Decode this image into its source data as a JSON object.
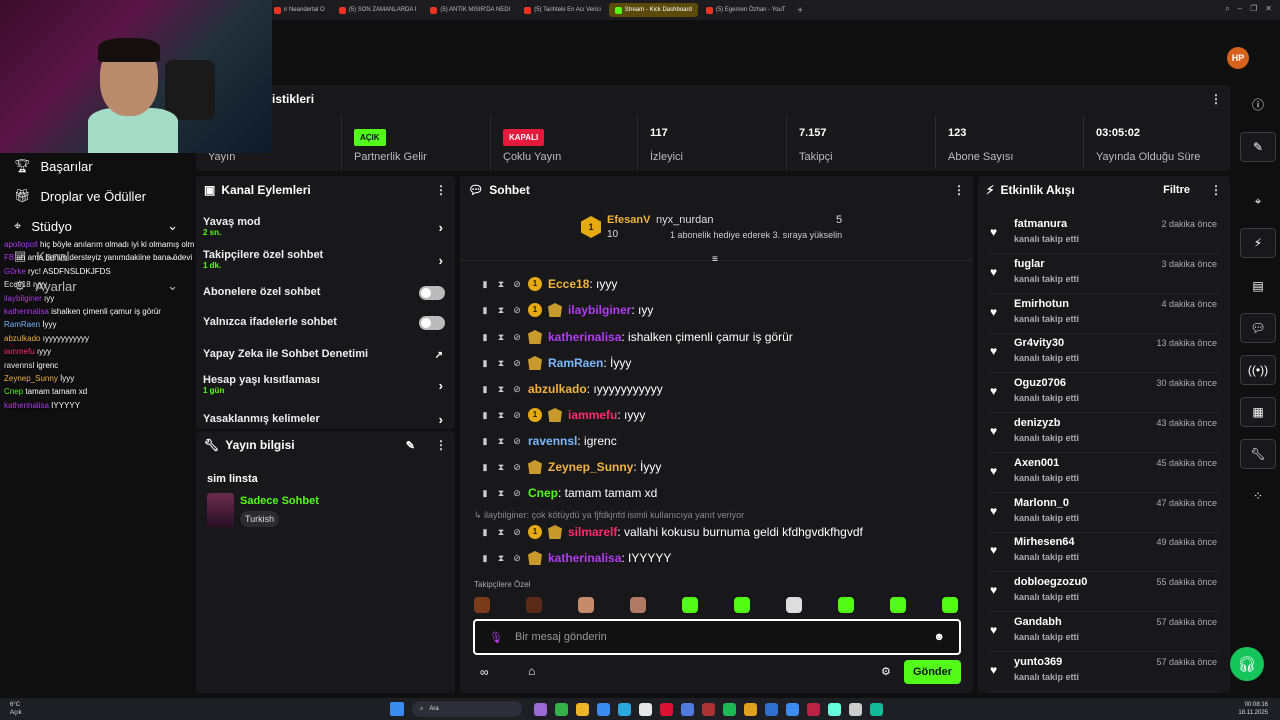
{
  "browser": {
    "tabs": [
      {
        "title": "ir Neandertal O"
      },
      {
        "title": "(5) SON ZAMANLARDA I"
      },
      {
        "title": "(5) ANTİK MISIR'DA NEDI"
      },
      {
        "title": "(5) Tarihteki En Acı Verici"
      },
      {
        "title": "Stream - Kick Dashboard",
        "active": true
      },
      {
        "title": "(5) Egemen Özhan - YouT"
      }
    ],
    "new_tab": "+"
  },
  "stats": {
    "title": "istikleri",
    "cells": [
      {
        "label": "Yayın",
        "value": ""
      },
      {
        "label": "Partnerlik Gelir",
        "badge": "AÇIK"
      },
      {
        "label": "Çoklu Yayın",
        "badge": "KAPALI"
      },
      {
        "label": "İzleyici",
        "value": "117"
      },
      {
        "label": "Takipçi",
        "value": "7.157"
      },
      {
        "label": "Abone Sayısı",
        "value": "123"
      },
      {
        "label": "Yayında Olduğu Süre",
        "value": "03:05:02"
      }
    ]
  },
  "nav": {
    "items": [
      {
        "label": "Başarılar",
        "icon": "trophy-icon"
      },
      {
        "label": "Droplar ve Ödüller",
        "icon": "gift-icon"
      },
      {
        "label": "Stüdyo",
        "icon": "studio-icon"
      },
      {
        "label": "Kanal",
        "icon": "channel-icon"
      },
      {
        "label": "Ayarlar",
        "icon": "settings-icon"
      }
    ]
  },
  "overlay_chat": [
    {
      "user": "apollopoll",
      "text": "hiç böyle anılarım olmadı iyi ki olmamış olmazda",
      "color": "#b13cf0"
    },
    {
      "user": "FB",
      "text": "ah ama benim dersteyiz yanımdakiine bana ödevi ilan al ukuğum. alpert çıktı ama kimse anlamadı",
      "color": "#b13cf0"
    },
    {
      "user": "G0rke",
      "text": "ryc! ASDFNSLDKJFDS",
      "color": "#b13cf0"
    },
    {
      "user": "Ecce18",
      "text": "ıyyy",
      "color": "#e7e7e7"
    },
    {
      "user": "ilaybilginer",
      "text": "ıyy",
      "color": "#b13cf0"
    },
    {
      "user": "katherinalisa",
      "text": "ishalken çimenli çamur iş görür",
      "color": "#b13cf0"
    },
    {
      "user": "RamRaen",
      "text": "İyyy",
      "color": "#7ab8ff"
    },
    {
      "user": "abzulkado",
      "text": "ıyyyyyyyyyyy",
      "color": "#f2b33d"
    },
    {
      "user": "iammefu",
      "text": "ıyyy",
      "color": "#ff2a6d"
    },
    {
      "user": "ravennsl",
      "text": "igrenc",
      "color": "#e7e7e7"
    },
    {
      "user": "Zeynep_Sunny",
      "text": "İyyy",
      "color": "#f2b33d"
    },
    {
      "user": "Cnep",
      "text": "tamam tamam xd",
      "color": "#53fc18"
    },
    {
      "user": "katherinalisa",
      "text": "IYYYYY",
      "color": "#b13cf0"
    }
  ],
  "actions": {
    "title": "Kanal Eylemleri",
    "items": [
      {
        "label": "Yavaş mod",
        "sub": "2 sn.",
        "control": "chevron"
      },
      {
        "label": "Takipçilere özel sohbet",
        "sub": "1 dk.",
        "control": "chevron"
      },
      {
        "label": "Abonelere özel sohbet",
        "sub": "",
        "control": "toggle"
      },
      {
        "label": "Yalnızca ifadelerle sohbet",
        "sub": "",
        "control": "toggle"
      },
      {
        "label": "Yapay Zeka ile Sohbet Denetimi",
        "sub": "",
        "control": "external"
      },
      {
        "label": "Hesap yaşı kısıtlaması",
        "sub": "1 gün",
        "control": "chevron"
      },
      {
        "label": "Yasaklanmış kelimeler",
        "sub": "",
        "control": "chevron"
      }
    ]
  },
  "info": {
    "title": "Yayın bilgisi",
    "stream_title": "sim linsta",
    "category": "Sadece Sohbet",
    "tag": "Turkish"
  },
  "chat": {
    "title": "Sohbet",
    "top": {
      "gifter": "EfesanV",
      "gifter_count": "10",
      "recipient": "nyx_nurdan",
      "count": "5",
      "event": "1 abonelik hediye ederek 3. sıraya yükselin"
    },
    "messages": [
      {
        "user": "Ecce18",
        "text": ": ıyyy",
        "color": "#f2b33d",
        "sub": true,
        "crest": false
      },
      {
        "user": "ilaybilginer",
        "text": ": ıyy",
        "color": "#b13cf0",
        "sub": true,
        "crest": true
      },
      {
        "user": "katherinalisa",
        "text": ": ishalken çimenli çamur iş görür",
        "color": "#b13cf0",
        "sub": false,
        "crest": true
      },
      {
        "user": "RamRaen",
        "text": ": İyyy",
        "color": "#7ab8ff",
        "sub": false,
        "crest": true
      },
      {
        "user": "abzulkado",
        "text": ": ıyyyyyyyyyyy",
        "color": "#f2b33d",
        "sub": false,
        "crest": false
      },
      {
        "user": "iammefu",
        "text": ": ıyyy",
        "color": "#ff2a6d",
        "sub": true,
        "crest": true
      },
      {
        "user": "ravennsl",
        "text": ": igrenc",
        "color": "#7ab8ff",
        "sub": false,
        "crest": false
      },
      {
        "user": "Zeynep_Sunny",
        "text": ": İyyy",
        "color": "#f2b33d",
        "sub": false,
        "crest": true
      },
      {
        "user": "Cnep",
        "text": ": tamam tamam xd",
        "color": "#53fc18",
        "sub": false,
        "crest": false
      },
      {
        "user": "silmarelf",
        "text": ": vallahi kokusu burnuma geldi kfdhgvdkfhgvdf",
        "color": "#ff2a6d",
        "sub": true,
        "crest": true,
        "reply": "ilaybilginer: çok kötüydü ya fjfdkjnfd isimli kullanıcıya yanıt veriyor"
      },
      {
        "user": "katherinalisa",
        "text": ": IYYYYY",
        "color": "#b13cf0",
        "sub": false,
        "crest": true
      }
    ],
    "emote_label": "Takipçilere Özel",
    "input_placeholder": "Bir mesaj gönderin",
    "send_label": "Gönder"
  },
  "activity": {
    "title": "Etkinlik Akışı",
    "filter": "Filtre",
    "action_text": "kanalı takip etti",
    "events": [
      {
        "name": "fatmanura",
        "time": "2 dakika önce"
      },
      {
        "name": "fuglar",
        "time": "3 dakika önce"
      },
      {
        "name": "Emirhotun",
        "time": "4 dakika önce"
      },
      {
        "name": "Gr4vity30",
        "time": "13 dakika önce"
      },
      {
        "name": "Oguz0706",
        "time": "30 dakika önce"
      },
      {
        "name": "denizyzb",
        "time": "43 dakika önce"
      },
      {
        "name": "Axen001",
        "time": "45 dakika önce"
      },
      {
        "name": "Marlonn_0",
        "time": "47 dakika önce"
      },
      {
        "name": "Mirhesen64",
        "time": "49 dakika önce"
      },
      {
        "name": "dobloegzozu0",
        "time": "55 dakika önce"
      },
      {
        "name": "Gandabh",
        "time": "57 dakika önce"
      },
      {
        "name": "yunto369",
        "time": "57 dakika önce"
      }
    ]
  },
  "taskbar": {
    "weather_temp": "6°C",
    "weather_text": "Açık",
    "search": "Ara",
    "time": "00:08:16",
    "date": "18.11.2025"
  },
  "colors": {
    "accent": "#53fc18",
    "danger": "#e5193b",
    "panel": "#18181b"
  }
}
